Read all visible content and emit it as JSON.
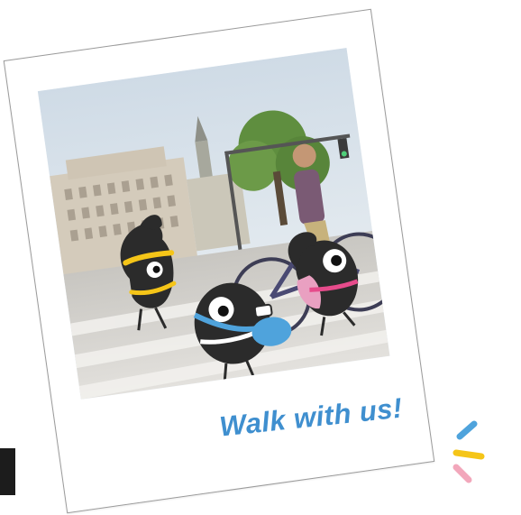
{
  "caption": {
    "text": "Walk with us!",
    "color": "#3f8fcf"
  },
  "photo": {
    "scene": "street-crossing-photo",
    "characters": [
      {
        "name": "mascot-yellow-headband",
        "accent_color": "#f5c518"
      },
      {
        "name": "mascot-blue-bag-camera",
        "accent_color": "#4fa3dc"
      },
      {
        "name": "mascot-pink-backpack",
        "accent_color": "#e64b8b"
      }
    ]
  },
  "decoration": {
    "sparkle_colors": [
      "#4fa3dc",
      "#f5c518",
      "#f2a7bb"
    ]
  }
}
